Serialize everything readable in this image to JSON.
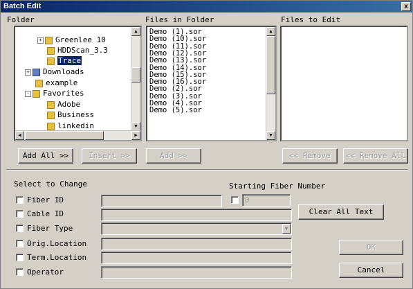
{
  "window": {
    "title": "Batch Edit",
    "close_glyph": "x"
  },
  "sections": {
    "folder": "Folder",
    "files_in_folder": "Files in Folder",
    "files_to_edit": "Files to Edit"
  },
  "folder_tree": [
    {
      "label": "Greenlee 10",
      "expander": "+",
      "icon": "folder-icon"
    },
    {
      "label": "HDDScan_3.3",
      "expander": "",
      "icon": "folder-icon"
    },
    {
      "label": "Trace",
      "expander": "",
      "icon": "folder-icon",
      "selected": true
    },
    {
      "label": "Downloads",
      "expander": "+",
      "icon": "folder-icon"
    },
    {
      "label": "example",
      "expander": "",
      "icon": "folder-icon"
    },
    {
      "label": "Favorites",
      "expander": "-",
      "icon": "folder-icon"
    },
    {
      "label": "Adobe",
      "expander": "",
      "icon": "folder-icon"
    },
    {
      "label": "Business",
      "expander": "",
      "icon": "folder-icon"
    },
    {
      "label": "linkedin",
      "expander": "",
      "icon": "folder-icon"
    }
  ],
  "files": [
    "Demo (1).sor",
    "Demo (10).sor",
    "Demo (11).sor",
    "Demo (12).sor",
    "Demo (13).sor",
    "Demo (14).sor",
    "Demo (15).sor",
    "Demo (16).sor",
    "Demo (2).sor",
    "Demo (3).sor",
    "Demo (4).sor",
    "Demo (5).sor"
  ],
  "buttons": {
    "add_all": "Add All >>",
    "insert": "Insert >>",
    "add": "Add >>",
    "remove": "<< Remove",
    "remove_all": "<< Remove All",
    "clear_all_text": "Clear All Text",
    "ok": "OK",
    "cancel": "Cancel"
  },
  "select_to_change": {
    "label": "Select to Change",
    "fields": [
      {
        "label": "Fiber ID",
        "value": ""
      },
      {
        "label": "Cable ID",
        "value": ""
      },
      {
        "label": "Fiber Type",
        "value": ""
      },
      {
        "label": "Orig.Location",
        "value": ""
      },
      {
        "label": "Term.Location",
        "value": ""
      },
      {
        "label": "Operator",
        "value": ""
      }
    ]
  },
  "starting_fiber": {
    "label": "Starting Fiber Number",
    "value": "0"
  },
  "icons": {
    "scroll_up": "▲",
    "scroll_down": "▼",
    "scroll_left": "◀",
    "scroll_right": "▶",
    "combo_arrow": "▼"
  }
}
